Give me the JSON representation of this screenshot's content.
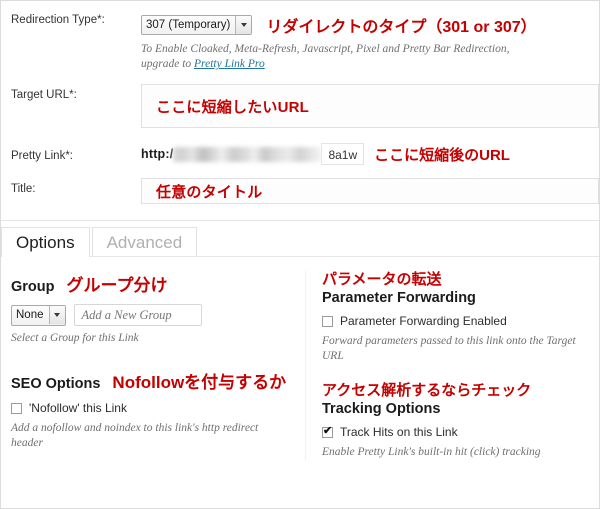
{
  "form": {
    "redirection": {
      "label": "Redirection Type*:",
      "selected": "307 (Temporary)",
      "annotation": "リダイレクトのタイプ（301 or 307）",
      "hint_line1": "To Enable Cloaked, Meta-Refresh, Javascript, Pixel and Pretty Bar Redirection,",
      "hint_line2_prefix": "upgrade to ",
      "hint_link": "Pretty Link Pro"
    },
    "target_url": {
      "label": "Target URL*:",
      "value": "ここに短縮したいURL"
    },
    "pretty_link": {
      "label": "Pretty Link*:",
      "protocol": "http:/",
      "slug": "8a1w",
      "annotation": "ここに短縮後のURL"
    },
    "title": {
      "label": "Title:",
      "value": "任意のタイトル"
    }
  },
  "tabs": [
    {
      "label": "Options",
      "active": true
    },
    {
      "label": "Advanced",
      "active": false
    }
  ],
  "panel": {
    "group": {
      "title": "Group",
      "annotation": "グループ分け",
      "select_value": "None",
      "new_group_placeholder": "Add a New Group",
      "hint": "Select a Group for this Link"
    },
    "seo": {
      "title": "SEO Options",
      "annotation": "Nofollowを付与するか",
      "checkbox_label": "'Nofollow' this Link",
      "checked": false,
      "hint": "Add a nofollow and noindex to this link's http redirect header"
    },
    "parameter_forwarding": {
      "annotation": "パラメータの転送",
      "title": "Parameter Forwarding",
      "checkbox_label": "Parameter Forwarding Enabled",
      "checked": false,
      "hint": "Forward parameters passed to this link onto the Target URL"
    },
    "tracking": {
      "annotation": "アクセス解析するならチェック",
      "title": "Tracking Options",
      "checkbox_label": "Track Hits on this Link",
      "checked": true,
      "hint": "Enable Pretty Link's built-in hit (click) tracking"
    }
  },
  "colors": {
    "annotation_red": "#c40000",
    "link_blue": "#21759b",
    "hint_gray": "#6f6f6f"
  }
}
